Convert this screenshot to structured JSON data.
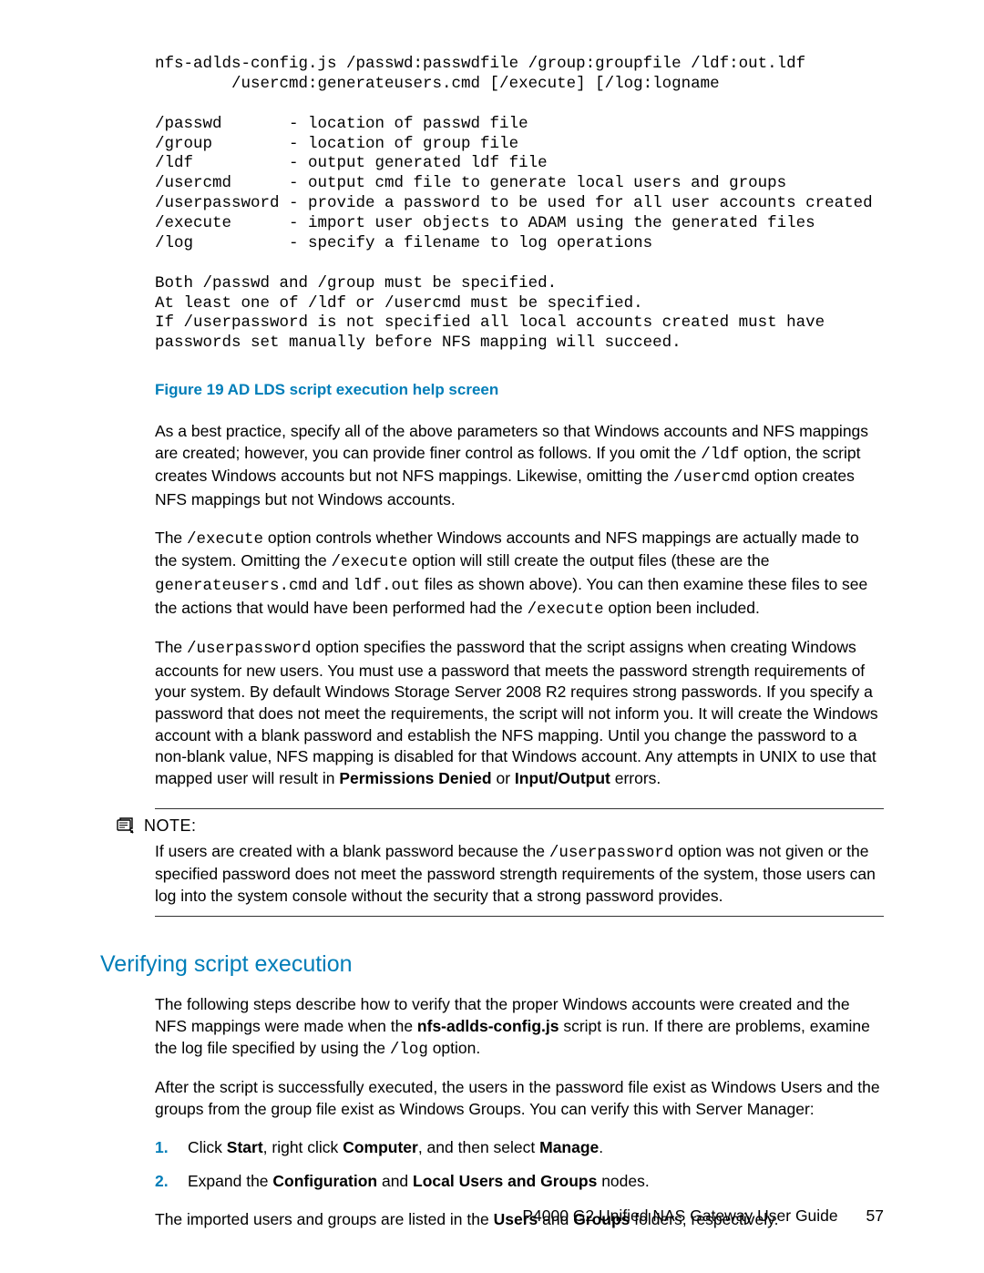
{
  "codeBlock": "nfs-adlds-config.js /passwd:passwdfile /group:groupfile /ldf:out.ldf\n        /usercmd:generateusers.cmd [/execute] [/log:logname\n\n/passwd       - location of passwd file\n/group        - location of group file\n/ldf          - output generated ldf file\n/usercmd      - output cmd file to generate local users and groups\n/userpassword - provide a password to be used for all user accounts created\n/execute      - import user objects to ADAM using the generated files\n/log          - specify a filename to log operations\n\nBoth /passwd and /group must be specified.\nAt least one of /ldf or /usercmd must be specified.\nIf /userpassword is not specified all local accounts created must have\npasswords set manually before NFS mapping will succeed.",
  "figureCaption": "Figure 19 AD LDS script execution help screen",
  "para1": {
    "t1": "As a best practice, specify all of the above parameters so that Windows accounts and NFS mappings are created; however, you can provide finer control as follows. If you omit the ",
    "c1": "/ldf",
    "t2": " option, the script creates Windows accounts but not NFS mappings. Likewise, omitting the ",
    "c2": "/usercmd",
    "t3": " option creates NFS mappings but not Windows accounts."
  },
  "para2": {
    "t1": "The ",
    "c1": "/execute",
    "t2": " option controls whether Windows accounts and NFS mappings are actually made to the system. Omitting the ",
    "c2": "/execute",
    "t3": " option will still create the output files (these are the ",
    "c3": "generateusers.cmd",
    "t4": " and ",
    "c4": "ldf.out",
    "t5": " files as shown above). You can then examine these files to see the actions that would have been performed had the ",
    "c5": "/execute",
    "t6": " option been included."
  },
  "para3": {
    "t1": "The ",
    "c1": "/userpassword",
    "t2": " option specifies the password that the script assigns when creating Windows accounts for new users. You must use a password that meets the password strength requirements of your system. By default Windows Storage Server 2008 R2 requires strong passwords. If you specify a password that does not meet the requirements, the script will not inform you. It will create the Windows account with a blank password and establish the NFS mapping. Until you change the password to a non-blank value, NFS mapping is disabled for that Windows account. Any attempts in UNIX to use that mapped user will result in ",
    "b1": "Permissions Denied",
    "t3": " or ",
    "b2": "Input/Output",
    "t4": " errors."
  },
  "note": {
    "label": "NOTE:",
    "body": {
      "t1": "If users are created with a blank password because the ",
      "c1": "/userpassword",
      "t2": " option was not given or the specified password does not meet the password strength requirements of the system, those users can log into the system console without the security that a strong password provides."
    }
  },
  "sectionHeading": "Verifying script execution",
  "para4": {
    "t1": "The following steps describe how to verify that the proper Windows accounts were created and the NFS mappings were made when the ",
    "b1": "nfs-adlds-config.js",
    "t2": " script is run. If there are problems, examine the log file specified by using the ",
    "c1": "/log",
    "t3": " option."
  },
  "para5": "After the script is successfully executed, the users in the password file exist as Windows Users and the groups from the group file exist as Windows Groups. You can verify this with Server Manager:",
  "steps": {
    "s1": {
      "t1": "Click ",
      "b1": "Start",
      "t2": ", right click ",
      "b2": "Computer",
      "t3": ", and then select ",
      "b3": "Manage",
      "t4": "."
    },
    "s2": {
      "t1": "Expand the ",
      "b1": "Configuration",
      "t2": " and ",
      "b2": "Local Users and Groups",
      "t3": " nodes."
    }
  },
  "para6": {
    "t1": "The imported users and groups are listed in the ",
    "b1": "Users",
    "t2": " and ",
    "b2": "Groups",
    "t3": " folders, respectively."
  },
  "footer": {
    "title": "P4000 G2 Unified NAS Gateway User Guide",
    "page": "57"
  }
}
